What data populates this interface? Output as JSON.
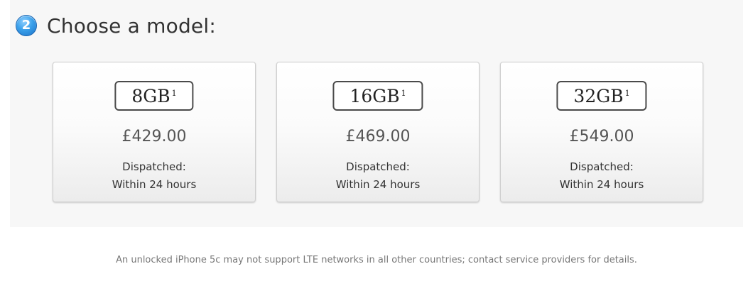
{
  "step": {
    "number": "2",
    "title": "Choose a model:"
  },
  "models": [
    {
      "capacity": "8GB",
      "footnote_mark": "1",
      "price": "£429.00",
      "dispatch_label": "Dispatched:",
      "dispatch_time": "Within 24 hours"
    },
    {
      "capacity": "16GB",
      "footnote_mark": "1",
      "price": "£469.00",
      "dispatch_label": "Dispatched:",
      "dispatch_time": "Within 24 hours"
    },
    {
      "capacity": "32GB",
      "footnote_mark": "1",
      "price": "£549.00",
      "dispatch_label": "Dispatched:",
      "dispatch_time": "Within 24 hours"
    }
  ],
  "footnote": "An unlocked iPhone 5c may not support LTE networks in all other countries; contact service providers for details.",
  "colors": {
    "step_badge": "#2f8fe0",
    "title_text": "#333333",
    "card_border": "#cfcfcf",
    "panel_background": "#f7f7f7"
  },
  "icons": {
    "step_badge": "step-number-icon"
  }
}
